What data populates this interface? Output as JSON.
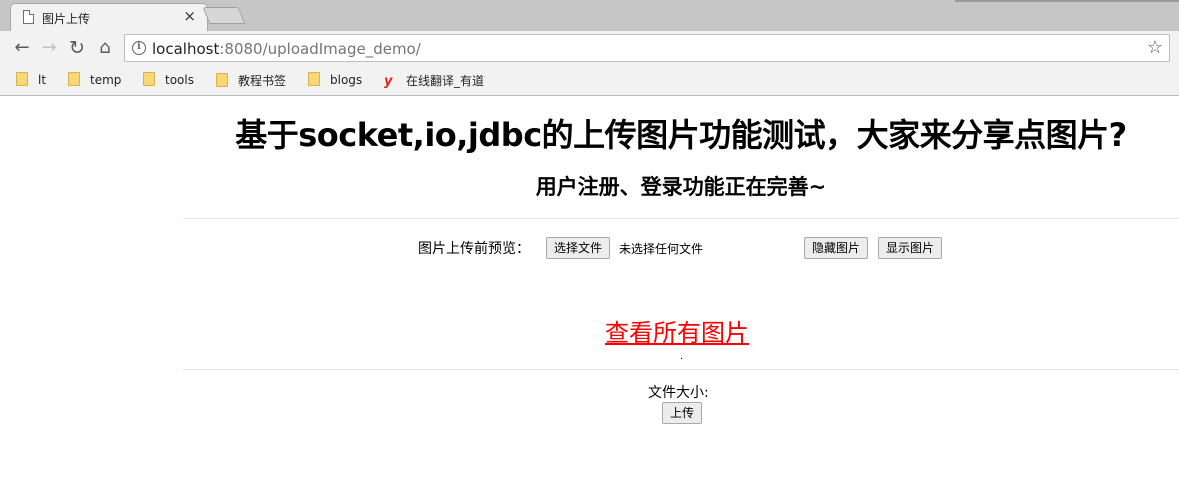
{
  "browser": {
    "tab_title": "图片上传",
    "tab_close": "×",
    "url_host": "localhost",
    "url_rest": ":8080/uploadImage_demo/",
    "info_glyph": "i",
    "star_glyph": "☆",
    "nav_back": "←",
    "nav_forward": "→",
    "nav_reload": "↻",
    "nav_home": "⌂"
  },
  "bookmarks": [
    {
      "label": "lt",
      "icon": "folder-icon"
    },
    {
      "label": "temp",
      "icon": "folder-icon"
    },
    {
      "label": "tools",
      "icon": "folder-icon"
    },
    {
      "label": "教程书签",
      "icon": "folder-icon"
    },
    {
      "label": "blogs",
      "icon": "folder-icon"
    },
    {
      "label": "在线翻译_有道",
      "icon": "youdao-icon",
      "icon_glyph": "y"
    }
  ],
  "page": {
    "title": "基于socket,io,jdbc的上传图片功能测试，大家来分享点图片?",
    "subtitle": "用户注册、登录功能正在完善~",
    "preview_label": "图片上传前预览：",
    "file_button": "选择文件",
    "file_status": "未选择任何文件",
    "hide_button": "隐藏图片",
    "show_button": "显示图片",
    "view_all_link": "查看所有图片",
    "dot": ".",
    "size_label": "文件大小:",
    "upload_button": "上传"
  },
  "colors": {
    "link": "#ff0000",
    "chrome_bg": "#f2f2f2",
    "tabstrip_bg": "#c6c6c6",
    "folder": "#f8d775",
    "youdao": "#e2231a"
  }
}
